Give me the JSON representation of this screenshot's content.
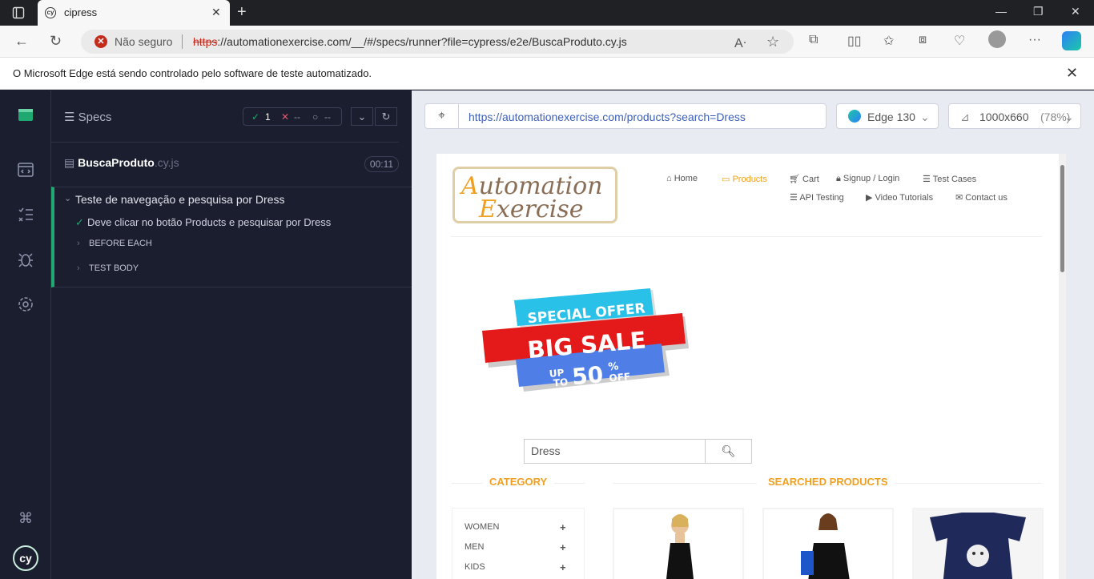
{
  "browser": {
    "tab_title": "cipress",
    "not_secure": "Não seguro",
    "url_scheme": "https",
    "url_rest": "://automationexercise.com/__/#/specs/runner?file=cypress/e2e/BuscaProduto.cy.js",
    "info_message": "O Microsoft Edge está sendo controlado pelo software de teste automatizado."
  },
  "runner": {
    "specs_label": "Specs",
    "passed_count": "1",
    "failed_count": "--",
    "pending_count": "--",
    "spec_name": "BuscaProduto",
    "spec_ext": ".cy.js",
    "duration": "00:11",
    "suite_title": "Teste de navegação e pesquisa por Dress",
    "test_title": "Deve clicar no botão Products e pesquisar por Dress",
    "hooks": [
      "BEFORE EACH",
      "TEST BODY"
    ]
  },
  "aut": {
    "url": "https://automationexercise.com/products?search=Dress",
    "browser_label": "Edge 130",
    "viewport": "1000x660",
    "zoom": "(78%)"
  },
  "site": {
    "logo_line1_cap": "A",
    "logo_line1": "utomation",
    "logo_line2_cap": "E",
    "logo_line2": "xercise",
    "nav": {
      "home": "Home",
      "products": "Products",
      "cart": "Cart",
      "signup": "Signup / Login",
      "test_cases": "Test Cases",
      "api_testing": "API Testing",
      "video_tutorials": "Video Tutorials",
      "contact_us": "Contact us"
    },
    "banner": {
      "line1": "SPECIAL OFFER",
      "line2": "BIG SALE",
      "up": "UP",
      "to": "TO",
      "value": "50",
      "pct": "%",
      "off": "OFF"
    },
    "search_value": "Dress",
    "category_heading": "CATEGORY",
    "searched_heading": "SEARCHED PRODUCTS",
    "categories": [
      "WOMEN",
      "MEN",
      "KIDS"
    ]
  },
  "colors": {
    "accent": "#f0a020",
    "pass": "#1fa971",
    "link": "#3c5fb8"
  }
}
